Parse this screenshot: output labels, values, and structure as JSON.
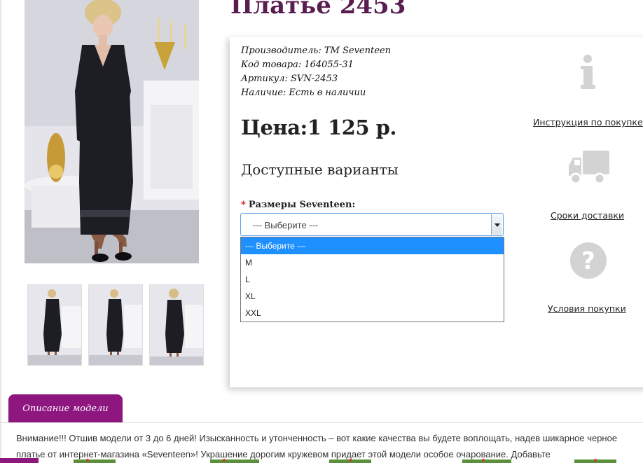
{
  "product": {
    "title": "Платье 2453",
    "meta": [
      {
        "label": "Производитель:",
        "value": "TM Seventeen"
      },
      {
        "label": "Код товара:",
        "value": "164055-31"
      },
      {
        "label": "Артикул:",
        "value": "SVN-2453"
      },
      {
        "label": "Наличие:",
        "value": "Есть в наличии"
      }
    ],
    "price": "Цена:1 125 р.",
    "variants_title": "Доступные варианты",
    "size_label": "Размеры Seventeen:",
    "size_required_mark": "*"
  },
  "size_select": {
    "value": "--- Выберите ---",
    "options": [
      "--- Выберите ---",
      "M",
      "L",
      "XL",
      "XXL"
    ],
    "selected_index": 0
  },
  "side_links": [
    {
      "icon": "info-icon",
      "label": "Инструкция по покупке"
    },
    {
      "icon": "delivery-truck-icon",
      "label": "Сроки доставки"
    },
    {
      "icon": "question-icon",
      "label": "Условия покупки"
    }
  ],
  "description": {
    "tab_label": "Описание модели",
    "text": "Внимание!!! Отшив модели от 3 до 6 дней! Изысканность и утонченность – вот какие качества вы будете воплощать, надев шикарное черное платье от интернет-магазина «Seventeen»! Украшение дорогим кружевом придает этой модели особое очарование. Добавьте"
  },
  "colors": {
    "title": "#5a1d4f",
    "tab": "#8d167f",
    "select_highlight": "#1e90ff",
    "icon_grey": "#d3d3d3"
  }
}
